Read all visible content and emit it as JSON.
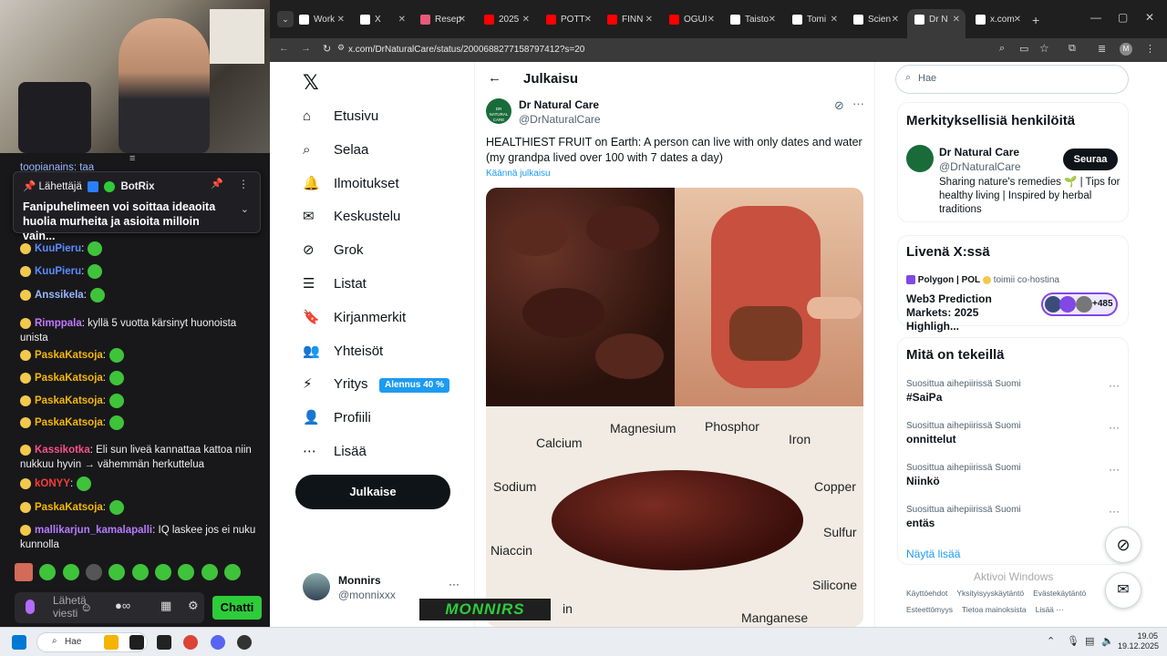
{
  "stream": {
    "pinned": {
      "header": "Lähettäjä",
      "sender": "BotRix",
      "message": "Fanipuhelimeen voi soittaa ideaoita huolia murheita ja asioita milloin vain..."
    },
    "top_partial": "toopianains: taa",
    "messages": [
      {
        "user": "KuuPieru",
        "text": ":",
        "color": "#5b8cff"
      },
      {
        "user": "KuuPieru",
        "text": ":",
        "color": "#5b8cff"
      },
      {
        "user": "Anssikela",
        "text": ":",
        "color": "#9ab8ff"
      },
      {
        "user": "Rimppala",
        "text": ": kyllä 5 vuotta kärsinyt huonoista unista",
        "color": "#c278ff"
      },
      {
        "user": "PaskaKatsoja",
        "text": ":",
        "color": "#f5b700"
      },
      {
        "user": "PaskaKatsoja",
        "text": ":",
        "color": "#f5b700"
      },
      {
        "user": "PaskaKatsoja",
        "text": ":",
        "color": "#f5b700"
      },
      {
        "user": "PaskaKatsoja",
        "text": ":",
        "color": "#f5b700"
      },
      {
        "user": "Kassikotka",
        "text": ": Eli sun liveä kannattaa kattoa niin nukkuu hyvin → vähemmän herkuttelua",
        "color": "#ff4f8b"
      },
      {
        "user": "kONYY",
        "text": ":",
        "color": "#ff3b3b"
      },
      {
        "user": "PaskaKatsoja",
        "text": ":",
        "color": "#f5b700"
      },
      {
        "user": "mallikarjun_kamalapalli",
        "text": ": IQ laskee jos ei nuku kunnolla",
        "color": "#b77bff"
      }
    ],
    "input_placeholder": "Lähetä viesti",
    "chat_button": "Chatti",
    "logo_text": "MONNIRS"
  },
  "browser": {
    "tabs": [
      {
        "label": "Work",
        "color": "#ffffff"
      },
      {
        "label": "X",
        "color": "#ffffff"
      },
      {
        "label": "Resep",
        "color": "#e85a7a"
      },
      {
        "label": "2025",
        "color": "#ff0000"
      },
      {
        "label": "POTT",
        "color": "#ff0000"
      },
      {
        "label": "FINN",
        "color": "#ff0000"
      },
      {
        "label": "OGUI",
        "color": "#ff0000"
      },
      {
        "label": "Taisto",
        "color": "#ffffff"
      },
      {
        "label": "Tomi",
        "color": "#ffffff"
      },
      {
        "label": "Scien",
        "color": "#ffffff"
      },
      {
        "label": "Dr N",
        "color": "#ffffff"
      },
      {
        "label": "x.com",
        "color": "#ffffff"
      }
    ],
    "url": "x.com/DrNaturalCare/status/2000688277158797412?s=20",
    "profile_initial": "M"
  },
  "x": {
    "nav": [
      {
        "label": "Etusivu",
        "icon": "home-icon"
      },
      {
        "label": "Selaa",
        "icon": "search-icon"
      },
      {
        "label": "Ilmoitukset",
        "icon": "bell-icon"
      },
      {
        "label": "Keskustelu",
        "icon": "mail-icon"
      },
      {
        "label": "Grok",
        "icon": "grok-icon"
      },
      {
        "label": "Listat",
        "icon": "list-icon"
      },
      {
        "label": "Kirjanmerkit",
        "icon": "bookmark-icon"
      },
      {
        "label": "Yhteisöt",
        "icon": "community-icon"
      },
      {
        "label": "Yritys",
        "icon": "bolt-icon"
      },
      {
        "label": "Profiili",
        "icon": "person-icon"
      },
      {
        "label": "Lisää",
        "icon": "more-icon"
      }
    ],
    "business_badge": "Alennus 40 %",
    "post_button": "Julkaise",
    "account": {
      "name": "Monnirs",
      "handle": "@monnixxx"
    },
    "header_title": "Julkaisu",
    "tweet": {
      "author": "Dr Natural Care",
      "handle": "@DrNaturalCare",
      "avatar_text": "DR NATURAL CARE",
      "text": "HEALTHIEST FRUIT on Earth: A person can live with only dates and water (my grandpa lived over 100 with 7 dates a day)",
      "translate": "Käännä julkaisu",
      "nutrients": [
        "Magnesium",
        "Phosphor",
        "Calcium",
        "Iron",
        "Sodium",
        "Copper",
        "Sulfur",
        "Niaccin",
        "Silicone",
        "in",
        "Manganese"
      ]
    },
    "search_placeholder": "Hae",
    "relevant": {
      "title": "Merkityksellisiä henkilöitä",
      "name": "Dr Natural Care",
      "handle": "@DrNaturalCare",
      "bio": "Sharing nature's remedies 🌱 | Tips for healthy living | Inspired by herbal traditions",
      "follow": "Seuraa"
    },
    "live": {
      "title": "Livenä X:ssä",
      "host": "Polygon | POL",
      "cohost": "toimii co-hostina",
      "event": "Web3 Prediction Markets: 2025 Highligh...",
      "count": "+485"
    },
    "trends_title": "Mitä on tekeillä",
    "trends": [
      {
        "category": "Suosittua aihepiirissä Suomi",
        "name": "#SaiPa"
      },
      {
        "category": "Suosittua aihepiirissä Suomi",
        "name": "onnittelut"
      },
      {
        "category": "Suosittua aihepiirissä Suomi",
        "name": "Niinkö"
      },
      {
        "category": "Suosittua aihepiirissä Suomi",
        "name": "entäs"
      }
    ],
    "show_more": "Näytä lisää",
    "footer": [
      "Käyttöehdot",
      "Yksityisyyskäytäntö",
      "Evästekäytäntö",
      "Esteettömyys",
      "Tietoa mainoksista",
      "Lisää ···"
    ],
    "watermark": "Aktivoi Windows"
  },
  "taskbar": {
    "search": "Hae",
    "time": "19.05",
    "date": "19.12.2025"
  },
  "colors": {
    "x_blue": "#1d9bf0",
    "twitch_green": "#2dcd3a"
  }
}
